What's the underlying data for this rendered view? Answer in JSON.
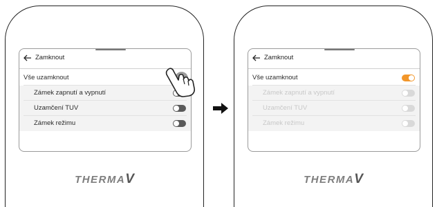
{
  "before": {
    "title": "Zamknout",
    "lock_all": {
      "label": "Vše uzamknout",
      "state": "pressed"
    },
    "items": [
      {
        "label": "Zámek zapnutí a vypnutí",
        "state": "off"
      },
      {
        "label": "Uzamčení TUV",
        "state": "off"
      },
      {
        "label": "Zámek režimu",
        "state": "off"
      }
    ],
    "logo": "THERMA",
    "logo_v": "V"
  },
  "after": {
    "title": "Zamknout",
    "lock_all": {
      "label": "Vše uzamknout",
      "state": "on"
    },
    "items": [
      {
        "label": "Zámek zapnutí a vypnutí",
        "state": "disabled"
      },
      {
        "label": "Uzamčení TUV",
        "state": "disabled"
      },
      {
        "label": "Zámek režimu",
        "state": "disabled"
      }
    ],
    "logo": "THERMA",
    "logo_v": "V"
  },
  "colors": {
    "toggle_on": "#f2962a",
    "toggle_off": "#5a5a5a",
    "toggle_disabled": "#d9d9d9",
    "disabled_text": "#c8c8c8"
  },
  "icons": [
    "back-arrow-icon",
    "pointing-hand-icon",
    "right-arrow-icon"
  ]
}
